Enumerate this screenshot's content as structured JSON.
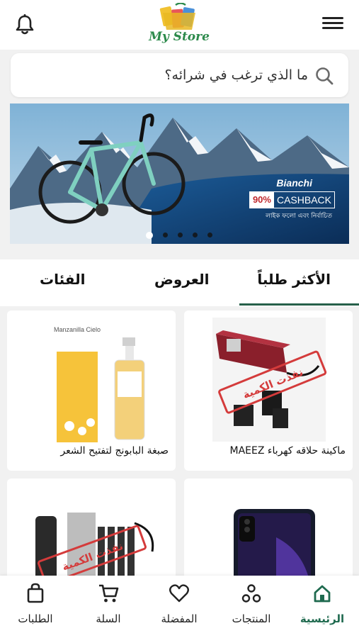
{
  "header": {
    "logo_text": "My Store"
  },
  "search": {
    "placeholder": "ما الذي ترغب في شرائه؟"
  },
  "banner": {
    "brand": "Bianchi",
    "cashback_percent": "90%",
    "cashback_label": "CASHBACK",
    "subtitle": "লাইক ফলো এবং নির্বাচিত",
    "slide_count": 5,
    "active_slide": 1
  },
  "tabs": [
    {
      "label": "الأكثر طلباً",
      "active": true
    },
    {
      "label": "العروض",
      "active": false
    },
    {
      "label": "الفئات",
      "active": false
    }
  ],
  "products": [
    {
      "title": "ماكينة حلاقه كهرباء MAEEZ",
      "badge": "نفذت الكمية"
    },
    {
      "title": "صبغة البابونج لتفتيح الشعر",
      "package_text": "Manzanilla Cielo"
    },
    {
      "title": "",
      "badge": ""
    },
    {
      "title": "",
      "badge": "نفذت الكمية"
    }
  ],
  "bottom_nav": [
    {
      "label": "الرئيسية",
      "icon": "home-icon",
      "active": true
    },
    {
      "label": "المنتجات",
      "icon": "products-icon",
      "active": false
    },
    {
      "label": "المفضلة",
      "icon": "heart-icon",
      "active": false
    },
    {
      "label": "السلة",
      "icon": "cart-icon",
      "active": false
    },
    {
      "label": "الطلبات",
      "icon": "bag-icon",
      "active": false
    }
  ],
  "colors": {
    "accent": "#1f6a4f",
    "tab_underline": "#27604a",
    "badge_red": "#d43b3b",
    "background": "#f1f1f1"
  }
}
